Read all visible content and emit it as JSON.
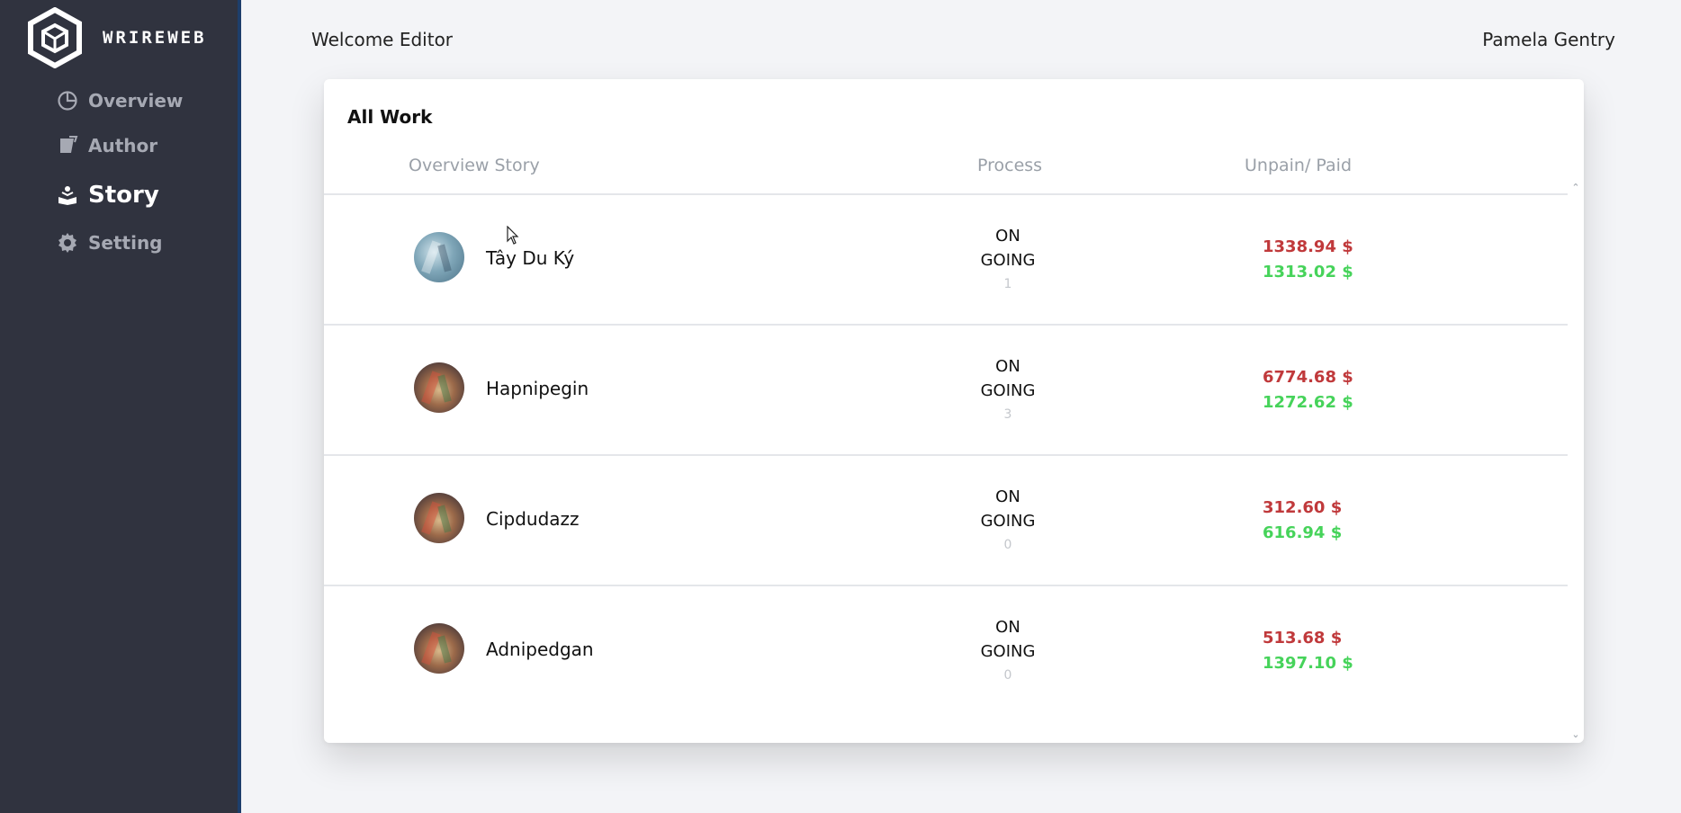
{
  "sidebar": {
    "logo_text": "WRIREWEB",
    "items": [
      {
        "label": "Overview",
        "icon": "pie-chart-icon",
        "active": false
      },
      {
        "label": "Author",
        "icon": "notebook-icon",
        "active": false
      },
      {
        "label": "Story",
        "icon": "reading-icon",
        "active": true
      },
      {
        "label": "Setting",
        "icon": "gear-icon",
        "active": false
      }
    ]
  },
  "header": {
    "welcome": "Welcome Editor",
    "user": "Pamela Gentry"
  },
  "card": {
    "title": "All Work",
    "columns": {
      "story": "Overview Story",
      "process": "Process",
      "paid": "Unpain/ Paid"
    },
    "rows": [
      {
        "name": "Tây Du Ký",
        "status_line1": "ON",
        "status_line2": "GOING",
        "count": "1",
        "unpaid": "1338.94 $",
        "paid": "1313.02 $"
      },
      {
        "name": "Hapnipegin",
        "status_line1": "ON",
        "status_line2": "GOING",
        "count": "3",
        "unpaid": "6774.68 $",
        "paid": "1272.62 $"
      },
      {
        "name": "Cipdudazz",
        "status_line1": "ON",
        "status_line2": "GOING",
        "count": "0",
        "unpaid": "312.60 $",
        "paid": "616.94 $"
      },
      {
        "name": "Adnipedgan",
        "status_line1": "ON",
        "status_line2": "GOING",
        "count": "0",
        "unpaid": "513.68 $",
        "paid": "1397.10 $"
      }
    ]
  },
  "colors": {
    "sidebar_bg": "#30333f",
    "unpaid": "#c0393b",
    "paid": "#46d35a"
  }
}
